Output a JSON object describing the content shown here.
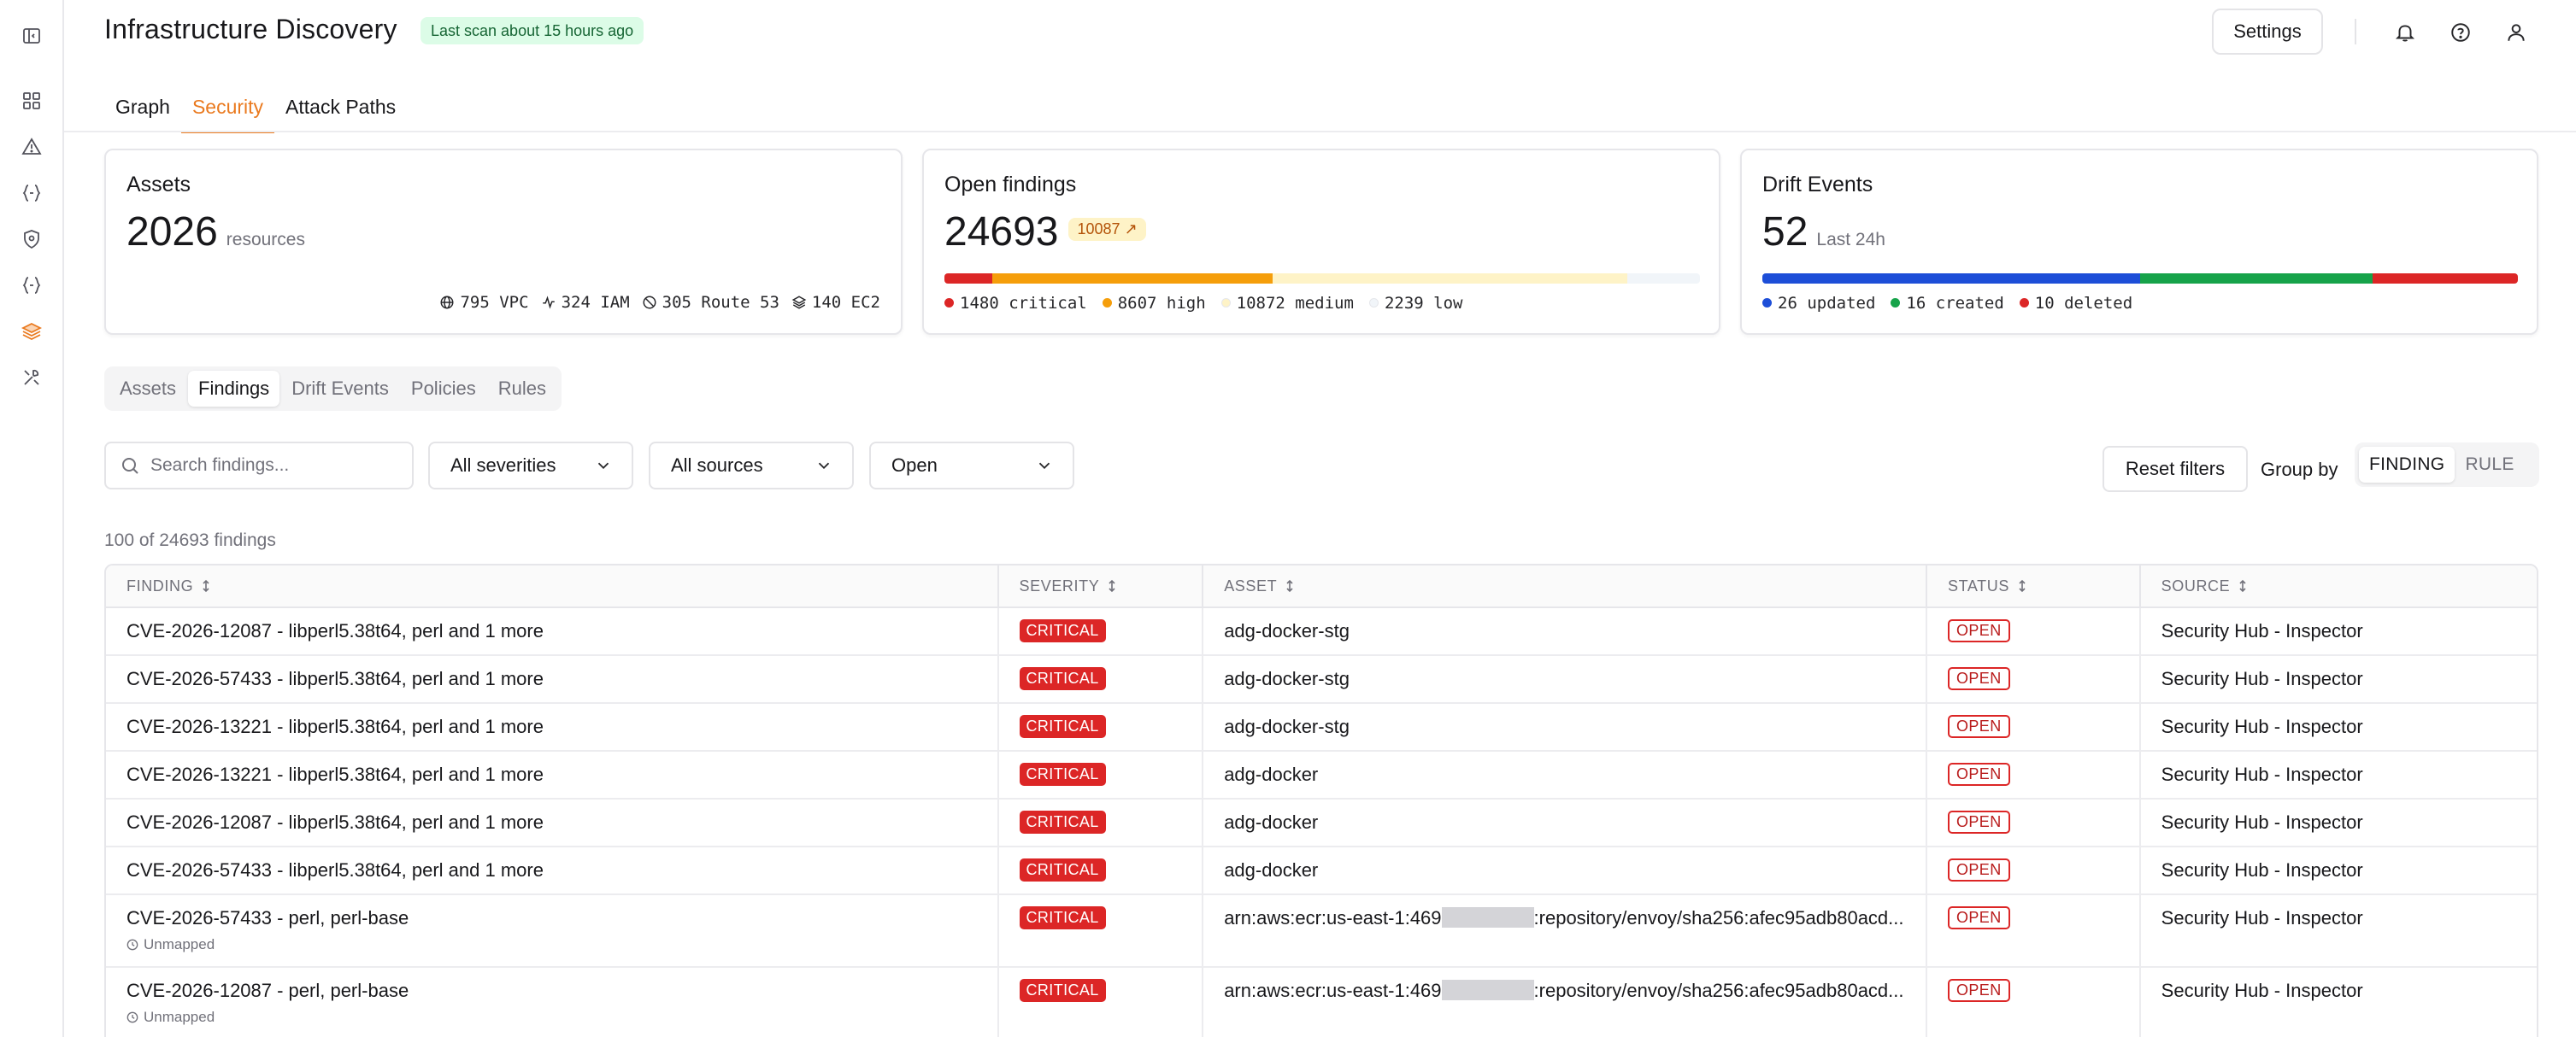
{
  "rail": {
    "icons": [
      "panel-toggle-icon",
      "dashboard-icon",
      "alert-triangle-icon",
      "code-braces-icon",
      "shield-icon",
      "code-braces-icon",
      "layers-icon",
      "tools-icon"
    ]
  },
  "header": {
    "title": "Infrastructure Discovery",
    "scan_badge": "Last scan about 15 hours ago",
    "settings_label": "Settings"
  },
  "top_tabs": [
    {
      "label": "Graph",
      "active": false
    },
    {
      "label": "Security",
      "active": true
    },
    {
      "label": "Attack Paths",
      "active": false
    }
  ],
  "cards": {
    "assets": {
      "title": "Assets",
      "count": "2026",
      "unit": "resources",
      "stats": [
        {
          "icon": "globe-icon",
          "label": "795 VPC"
        },
        {
          "icon": "activity-icon",
          "label": "324 IAM"
        },
        {
          "icon": "route-icon",
          "label": "305 Route 53"
        },
        {
          "icon": "stack-icon",
          "label": "140 EC2"
        }
      ]
    },
    "findings": {
      "title": "Open findings",
      "count": "24693",
      "badge": "10087",
      "legend": [
        {
          "label": "1480 critical",
          "color": "#dc2626",
          "value": 1480
        },
        {
          "label": "8607 high",
          "color": "#f59e0b",
          "value": 8607
        },
        {
          "label": "10872 medium",
          "color": "#fef3c7",
          "value": 10872
        },
        {
          "label": "2239 low",
          "color": "#f1f5f9",
          "value": 2239
        }
      ]
    },
    "drift": {
      "title": "Drift Events",
      "count": "52",
      "unit": "Last 24h",
      "legend": [
        {
          "label": "26 updated",
          "color": "#1d4ed8",
          "value": 26
        },
        {
          "label": "16 created",
          "color": "#16a34a",
          "value": 16
        },
        {
          "label": "10 deleted",
          "color": "#dc2626",
          "value": 10
        }
      ]
    }
  },
  "sub_tabs": [
    {
      "label": "Assets",
      "active": false
    },
    {
      "label": "Findings",
      "active": true
    },
    {
      "label": "Drift Events",
      "active": false
    },
    {
      "label": "Policies",
      "active": false
    },
    {
      "label": "Rules",
      "active": false
    }
  ],
  "filters": {
    "search_placeholder": "Search findings...",
    "severity": "All severities",
    "source": "All sources",
    "status": "Open",
    "reset_label": "Reset filters",
    "group_by_label": "Group by",
    "group_by_options": [
      {
        "label": "FINDING",
        "active": true
      },
      {
        "label": "RULE",
        "active": false
      }
    ]
  },
  "count_line": "100 of 24693 findings",
  "table": {
    "columns": [
      "FINDING",
      "SEVERITY",
      "ASSET",
      "STATUS",
      "SOURCE"
    ],
    "rows": [
      {
        "finding": "CVE-2026-12087 - libperl5.38t64, perl and 1 more",
        "severity": "CRITICAL",
        "asset": "adg-docker-stg",
        "status": "OPEN",
        "source": "Security Hub - Inspector"
      },
      {
        "finding": "CVE-2026-57433 - libperl5.38t64, perl and 1 more",
        "severity": "CRITICAL",
        "asset": "adg-docker-stg",
        "status": "OPEN",
        "source": "Security Hub - Inspector"
      },
      {
        "finding": "CVE-2026-13221 - libperl5.38t64, perl and 1 more",
        "severity": "CRITICAL",
        "asset": "adg-docker-stg",
        "status": "OPEN",
        "source": "Security Hub - Inspector"
      },
      {
        "finding": "CVE-2026-13221 - libperl5.38t64, perl and 1 more",
        "severity": "CRITICAL",
        "asset": "adg-docker",
        "status": "OPEN",
        "source": "Security Hub - Inspector"
      },
      {
        "finding": "CVE-2026-12087 - libperl5.38t64, perl and 1 more",
        "severity": "CRITICAL",
        "asset": "adg-docker",
        "status": "OPEN",
        "source": "Security Hub - Inspector"
      },
      {
        "finding": "CVE-2026-57433 - libperl5.38t64, perl and 1 more",
        "severity": "CRITICAL",
        "asset": "adg-docker",
        "status": "OPEN",
        "source": "Security Hub - Inspector"
      },
      {
        "finding": "CVE-2026-57433 - perl, perl-base",
        "note": "Unmapped",
        "severity": "CRITICAL",
        "asset_prefix": "arn:aws:ecr:us-east-1:469",
        "asset_suffix": ":repository/envoy/sha256:afec95adb80acd...",
        "status": "OPEN",
        "source": "Security Hub - Inspector"
      },
      {
        "finding": "CVE-2026-12087 - perl, perl-base",
        "note": "Unmapped",
        "severity": "CRITICAL",
        "asset_prefix": "arn:aws:ecr:us-east-1:469",
        "asset_suffix": ":repository/envoy/sha256:afec95adb80acd...",
        "status": "OPEN",
        "source": "Security Hub - Inspector"
      }
    ]
  }
}
